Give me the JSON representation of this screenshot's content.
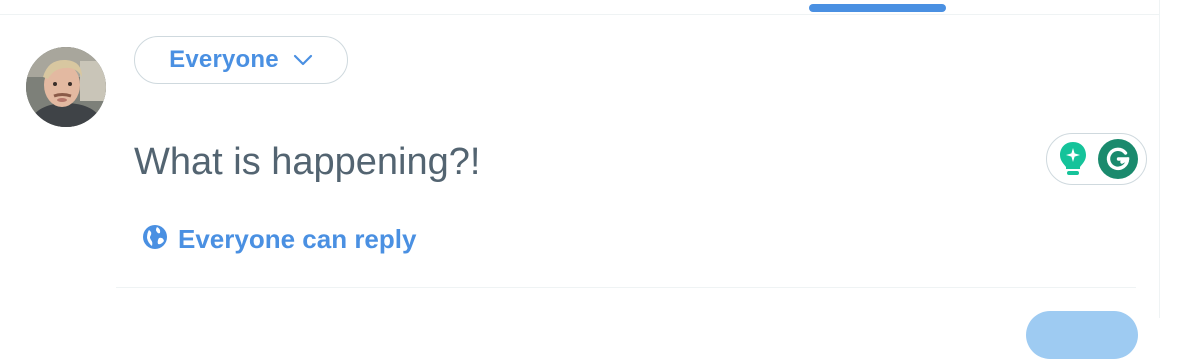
{
  "compose": {
    "audience_label": "Everyone",
    "placeholder": "What is happening?!",
    "reply_setting_label": "Everyone can reply"
  },
  "icons": {
    "audience_dropdown": "chevron-down-icon",
    "reply_setting": "globe-icon",
    "grammarly_suggestions": "lightbulb-sparkle-icon",
    "grammarly": "grammarly-g-icon"
  },
  "colors": {
    "accent": "#4a90e2",
    "placeholder_text": "#536471",
    "border": "#cfd9de",
    "divider": "#eff3f4",
    "grammarly_green": "#1a8a6d",
    "grammarly_teal": "#15c39a"
  }
}
